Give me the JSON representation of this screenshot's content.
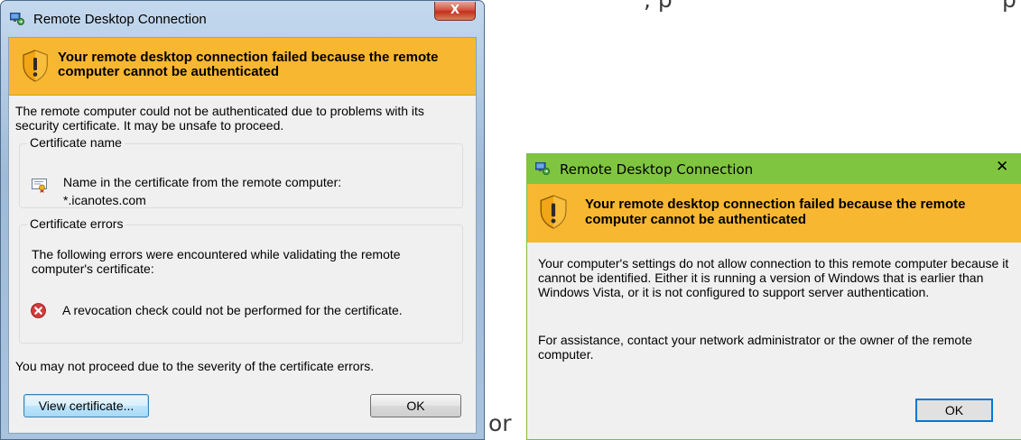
{
  "background": {
    "caption_left": ", p",
    "caption_right": "p",
    "separator": "or"
  },
  "win7_dialog": {
    "title": "Remote Desktop Connection",
    "close_glyph": "X",
    "banner": "Your remote desktop connection failed because the remote computer cannot be authenticated",
    "banner_icon": "shield-warning-icon",
    "description": "The remote computer could not be authenticated due to problems with its security certificate. It may be unsafe to proceed.",
    "certificate_group": {
      "title": "Certificate name",
      "label": "Name in the certificate from the remote computer:",
      "value": "*.icanotes.com"
    },
    "errors_group": {
      "title": "Certificate errors",
      "intro": "The following errors were encountered while validating the remote computer's certificate:",
      "items": [
        "A revocation check could not be performed for the certificate."
      ]
    },
    "footer": "You may not proceed due to the severity of the certificate errors.",
    "view_certificate_button": "View certificate...",
    "ok_button": "OK",
    "colors": {
      "banner": "#f7b731",
      "error": "#cc3333"
    }
  },
  "win10_dialog": {
    "title": "Remote Desktop Connection",
    "close_glyph": "✕",
    "banner": "Your remote desktop connection failed because the remote computer cannot be authenticated",
    "banner_icon": "shield-warning-icon",
    "paragraph1": "Your computer's settings do not allow connection to this remote computer because it cannot be identified. Either it is running a version of Windows that is earlier than Windows Vista, or it is not configured to support server authentication.",
    "paragraph2": "For assistance, contact your network administrator or the owner of the remote computer.",
    "ok_button": "OK",
    "colors": {
      "titlebar": "#80c540",
      "banner": "#f7b731",
      "focus": "#0078d7"
    }
  }
}
